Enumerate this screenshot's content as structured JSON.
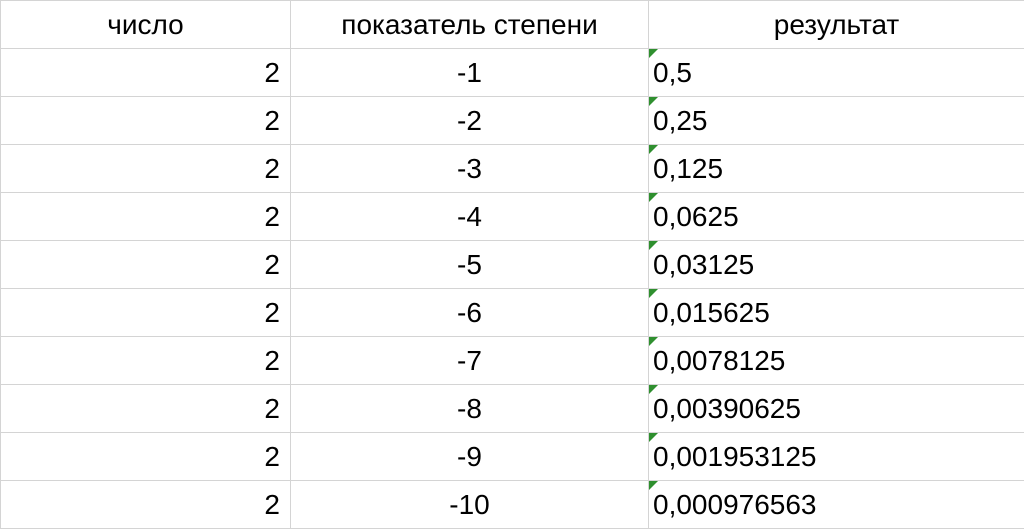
{
  "table": {
    "headers": {
      "number": "число",
      "exponent": "показатель степени",
      "result": "результат"
    },
    "rows": [
      {
        "number": "2",
        "exponent": "-1",
        "result": "0,5"
      },
      {
        "number": "2",
        "exponent": "-2",
        "result": "0,25"
      },
      {
        "number": "2",
        "exponent": "-3",
        "result": "0,125"
      },
      {
        "number": "2",
        "exponent": "-4",
        "result": "0,0625"
      },
      {
        "number": "2",
        "exponent": "-5",
        "result": "0,03125"
      },
      {
        "number": "2",
        "exponent": "-6",
        "result": "0,015625"
      },
      {
        "number": "2",
        "exponent": "-7",
        "result": "0,0078125"
      },
      {
        "number": "2",
        "exponent": "-8",
        "result": "0,00390625"
      },
      {
        "number": "2",
        "exponent": "-9",
        "result": "0,001953125"
      },
      {
        "number": "2",
        "exponent": "-10",
        "result": "0,000976563"
      }
    ]
  }
}
